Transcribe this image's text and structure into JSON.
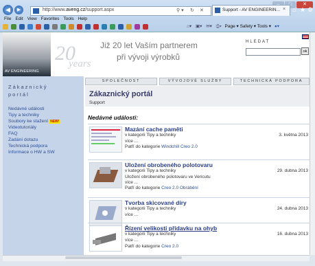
{
  "browser": {
    "url_prefix": "http://www.",
    "url_domain": "aveng.cz",
    "url_path": "/support.aspx",
    "tab_title": "Support - AV ENGINEERIN...",
    "menu": [
      "File",
      "Edit",
      "View",
      "Favorites",
      "Tools",
      "Help"
    ],
    "commands": "Page ▾   Safety ▾   Tools ▾"
  },
  "header": {
    "logo_text": "AV ENGINEERING",
    "years_number": "20",
    "years_word": "years",
    "slogan_line1": "Již 20 let Vaším partnerem",
    "slogan_line2": "při vývoji výrobků",
    "search_label": "HLEDAT",
    "search_button": "ok"
  },
  "nav": [
    "SPOLEČNOST",
    "VÝVOJOVÉ SLUŽBY",
    "TECHNICKÁ PODPORA"
  ],
  "sidebar": {
    "title_line1": "Zákaznický",
    "title_line2": "portál",
    "items": [
      {
        "label": "Nedávné události"
      },
      {
        "label": "Tipy a techniky"
      },
      {
        "label": "Soubory ke stažení",
        "badge": "NEW!"
      },
      {
        "label": "Videotutoriály"
      },
      {
        "label": "FAQ"
      },
      {
        "label": "Zadání dotazu"
      },
      {
        "label": "Technická podpora"
      },
      {
        "label": "Informace o HW a SW"
      }
    ]
  },
  "portal": {
    "title": "Zákaznický portál",
    "subtitle": "Support",
    "recent_heading": "Nedávné události:"
  },
  "events": [
    {
      "title": "Mazání cache paměti",
      "category": "v kategorii Tipy a techniky",
      "date": "3. května 2013",
      "desc": "",
      "more": "více ...",
      "tags_prefix": "Patří do kategorie",
      "tags": [
        "Windchill",
        "Creo 2.0"
      ]
    },
    {
      "title": "Uložení obrobeného polotovaru",
      "category": "v kategorii Tipy a techniky",
      "date": "29. dubna 2013",
      "desc": "Uložení obrobeného polotovaru ve Vericutu",
      "more": "více ...",
      "tags_prefix": "Patří do kategorie",
      "tags": [
        "Creo 2.0",
        "Obrábění"
      ]
    },
    {
      "title": "Tvorba skicované díry",
      "category": "v kategorii Tipy a techniky",
      "date": "24. dubna 2013",
      "desc": "",
      "more": "více ...",
      "tags_prefix": "",
      "tags": []
    },
    {
      "title": "Řízení velikosti přídavku na ohyb",
      "category": "v kategorii Tipy a techniky",
      "date": "16. dubna 2013",
      "desc": "",
      "more": "více ...",
      "tags_prefix": "Patří do kategorie",
      "tags": [
        "Creo 2.0"
      ]
    }
  ]
}
